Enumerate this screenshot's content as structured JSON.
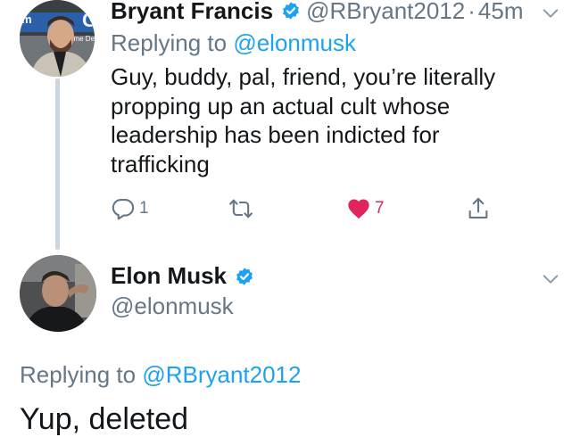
{
  "tweet_reply": {
    "author_name": "Bryant Francis",
    "author_handle": "@RBryant2012",
    "separator": "·",
    "timestamp": "45m",
    "replying_prefix": "Replying to ",
    "replying_to": "@elonmusk",
    "text_lines": [
      "Guy, buddy, pal, friend, you’re literally",
      "propping up an actual cult whose",
      "leadership has been indicted for",
      "trafficking"
    ],
    "actions": {
      "reply_count": "1",
      "retweet_count": "",
      "like_count": "7",
      "liked": true
    },
    "avatar_sign_text": "GO",
    "avatar_sign_text2": "ame Devel"
  },
  "tweet_main": {
    "author_name": "Elon Musk",
    "author_handle": "@elonmusk",
    "replying_prefix": "Replying to ",
    "replying_to": "@RBryant2012",
    "text": "Yup, deleted"
  },
  "icons": {
    "verified": "verified-badge-icon",
    "caret": "chevron-down-icon",
    "reply": "reply-icon",
    "retweet": "retweet-icon",
    "like": "heart-icon",
    "share": "share-icon"
  },
  "colors": {
    "accent": "#1da1f2",
    "muted": "#657786",
    "like": "#e0245e",
    "text": "#14171a",
    "thread_line": "#cbd6de"
  }
}
